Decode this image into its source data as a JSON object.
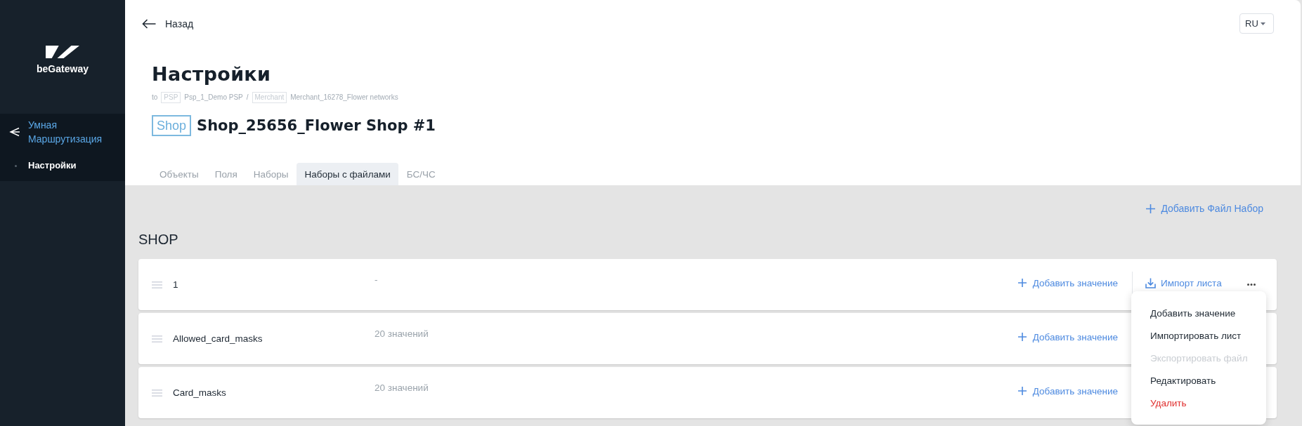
{
  "sidebar": {
    "logo": {
      "text": "beGateway"
    },
    "section": {
      "title": "Умная Маршрутизация",
      "selected": true
    },
    "items": [
      {
        "label": "Настройки",
        "selected": true
      }
    ]
  },
  "header": {
    "back": "Назад",
    "language": "RU",
    "title": "Настройки",
    "breadcrumb": {
      "prefix": "to",
      "items": [
        {
          "tag": "PSP",
          "name": "Psp_1_Demo PSP"
        },
        {
          "tag": "Merchant",
          "name": "Merchant_16278_Flower networks"
        }
      ],
      "separator": "/"
    },
    "entity": {
      "tag": "Shop",
      "name": "Shop_25656_Flower Shop #1"
    }
  },
  "tabs": [
    {
      "label": "Объекты",
      "selected": false
    },
    {
      "label": "Поля",
      "selected": false
    },
    {
      "label": "Наборы",
      "selected": false
    },
    {
      "label": "Наборы с файлами",
      "selected": true
    },
    {
      "label": "БС/ЧС",
      "selected": false
    }
  ],
  "toolbar": {
    "add_set": "Добавить Файл Набор"
  },
  "section": {
    "title": "SHOP"
  },
  "sets": [
    {
      "name": "1",
      "summary": "-",
      "add_value": "Добавить значение",
      "import": "Импорт листа",
      "menu": {
        "open": true,
        "items": [
          {
            "label": "Добавить значение",
            "kind": "normal",
            "disabled": false
          },
          {
            "label": "Импортировать лист",
            "kind": "normal",
            "disabled": false
          },
          {
            "label": "Экспортировать файл",
            "kind": "normal",
            "disabled": true
          },
          {
            "label": "Редактировать",
            "kind": "normal",
            "disabled": false
          },
          {
            "label": "Удалить",
            "kind": "danger",
            "disabled": false
          }
        ]
      }
    },
    {
      "name": "Allowed_card_masks",
      "summary": "20 значений",
      "add_value": "Добавить значение"
    },
    {
      "name": "Card_masks",
      "summary": "20 значений",
      "add_value": "Добавить значение"
    }
  ]
}
